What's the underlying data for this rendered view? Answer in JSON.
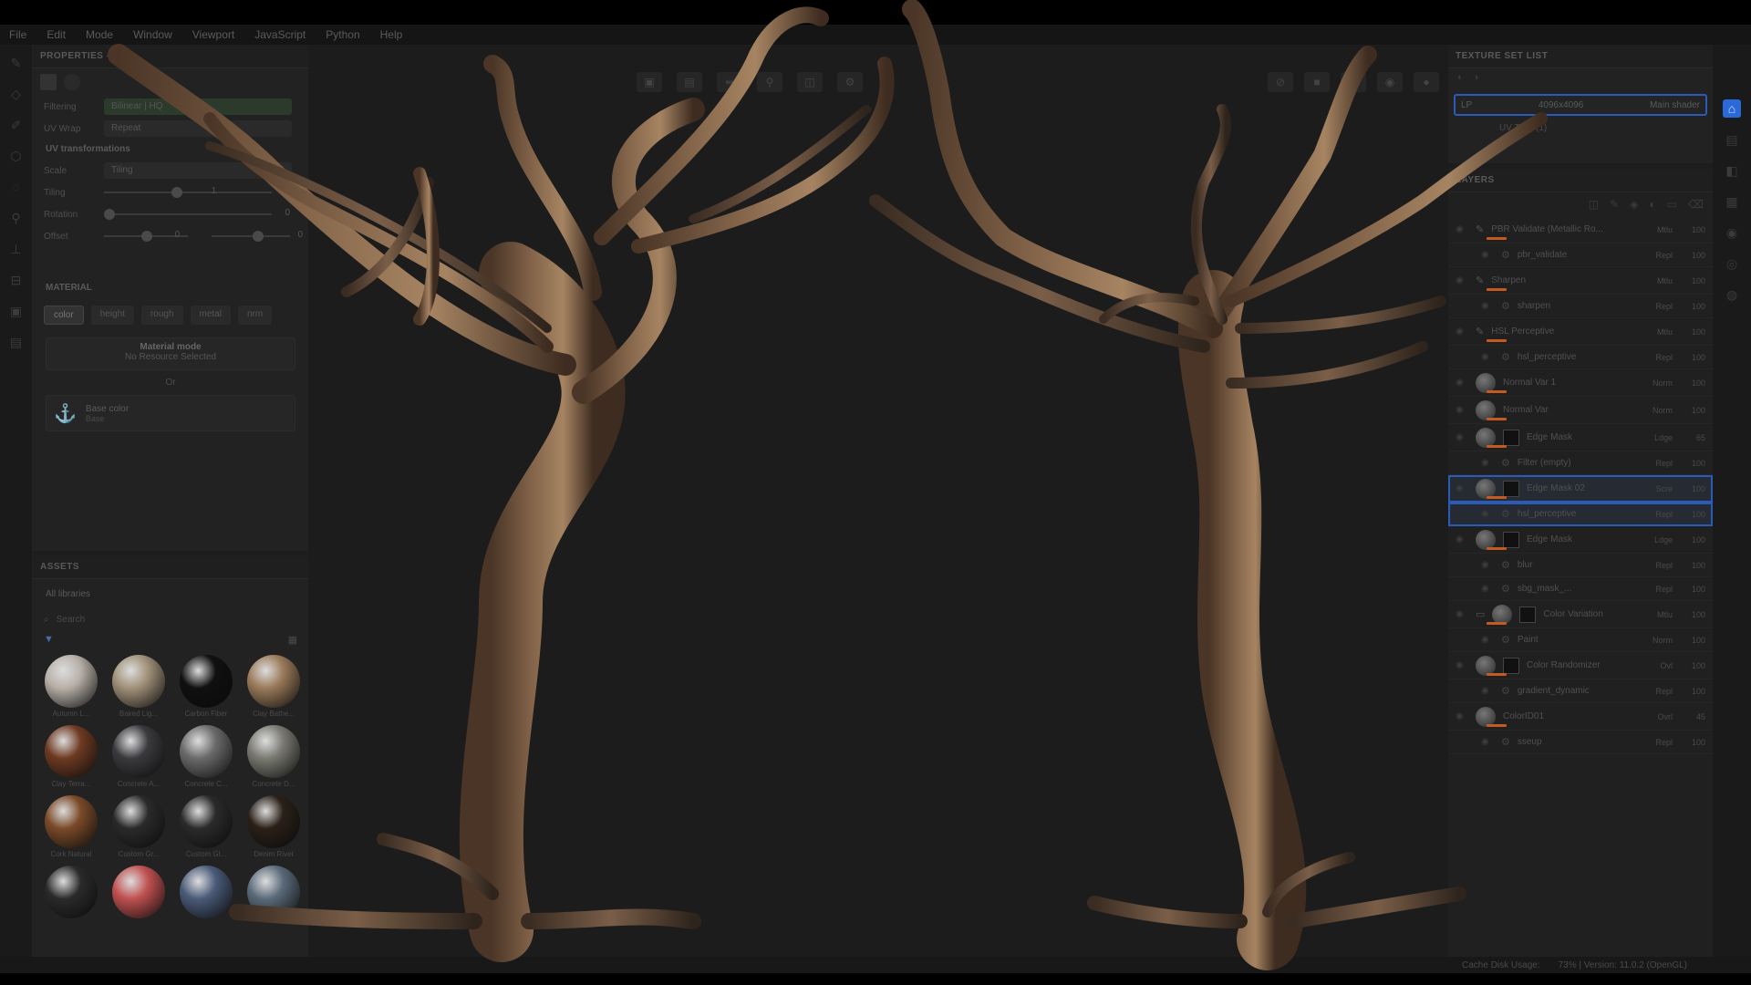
{
  "menu": [
    "File",
    "Edit",
    "Mode",
    "Window",
    "Viewport",
    "JavaScript",
    "Python",
    "Help"
  ],
  "properties": {
    "title": "PROPERTIES - FILL",
    "filtering_label": "Filtering",
    "filtering_value": "Bilinear | HQ",
    "uvwrap_label": "UV Wrap",
    "uvwrap_value": "Repeat",
    "uv_section": "UV transformations",
    "scale_label": "Scale",
    "scale_value": "Tiling",
    "tiling_label": "Tiling",
    "tiling_value": "1",
    "rotation_label": "Rotation",
    "rotation_value": "0",
    "offset_label": "Offset",
    "offset_value_1": "0",
    "offset_value_2": "0"
  },
  "material": {
    "title": "MATERIAL",
    "tabs": [
      "color",
      "height",
      "rough",
      "metal",
      "nrm"
    ],
    "mode_title": "Material mode",
    "mode_subtitle": "No Resource Selected",
    "or_label": "Or",
    "base_color_label": "Base color",
    "base_color_value": "Base"
  },
  "assets": {
    "title": "ASSETS",
    "library": "All libraries",
    "search_placeholder": "Search",
    "items": [
      {
        "name": "Autumn L...",
        "color": "#b8b0a8"
      },
      {
        "name": "Baked Lig...",
        "color": "#a09078"
      },
      {
        "name": "Carbon Fiber",
        "color": "#101010"
      },
      {
        "name": "Clay Bathe...",
        "color": "#9a7a5a"
      },
      {
        "name": "Clay Terra...",
        "color": "#6e3a22"
      },
      {
        "name": "Concrete A...",
        "color": "#3a3a3e"
      },
      {
        "name": "Concrete C...",
        "color": "#6a6a6a"
      },
      {
        "name": "Concrete D...",
        "color": "#7a7a72"
      },
      {
        "name": "Cork Natural",
        "color": "#7a4a28"
      },
      {
        "name": "Custom Gr...",
        "color": "#2a2a2a"
      },
      {
        "name": "Custom Gl...",
        "color": "#2a2a2a"
      },
      {
        "name": "Denim Rivet",
        "color": "#2a2018"
      },
      {
        "name": "",
        "color": "#2a2a2a"
      },
      {
        "name": "",
        "color": "#c05050"
      },
      {
        "name": "",
        "color": "#4a5a78"
      },
      {
        "name": "",
        "color": "#5a6a7a"
      }
    ]
  },
  "texture_set": {
    "title": "TEXTURE SET LIST",
    "name": "LP",
    "resolution": "4096x4096",
    "shader": "Main shader",
    "uv_tiles": "UV Tiles (1)"
  },
  "layers": {
    "title": "LAYERS",
    "items": [
      {
        "name": "PBR Validate (Metallic Ro...",
        "blend": "Mtlu",
        "opacity": "100",
        "sub": false,
        "kind": "paint"
      },
      {
        "name": "pbr_validate",
        "blend": "Repl",
        "opacity": "100",
        "sub": true
      },
      {
        "name": "Sharpen",
        "blend": "Mtlu",
        "opacity": "100",
        "sub": false,
        "kind": "paint"
      },
      {
        "name": "sharpen",
        "blend": "Repl",
        "opacity": "100",
        "sub": true
      },
      {
        "name": "HSL Perceptive",
        "blend": "Mtlu",
        "opacity": "100",
        "sub": false,
        "kind": "paint"
      },
      {
        "name": "hsl_perceptive",
        "blend": "Repl",
        "opacity": "100",
        "sub": true
      },
      {
        "name": "Normal Var 1",
        "blend": "Norm",
        "opacity": "100",
        "sub": false,
        "kind": "ball"
      },
      {
        "name": "Normal Var",
        "blend": "Norm",
        "opacity": "100",
        "sub": false,
        "kind": "ball"
      },
      {
        "name": "Edge Mask",
        "blend": "Ldge",
        "opacity": "65",
        "sub": false,
        "kind": "ballmask"
      },
      {
        "name": "Filter (empty)",
        "blend": "Repl",
        "opacity": "100",
        "sub": true
      },
      {
        "name": "Edge Mask 02",
        "blend": "Scre",
        "opacity": "100",
        "sub": false,
        "kind": "ballmask",
        "selected": true
      },
      {
        "name": "hsl_perceptive",
        "blend": "Repl",
        "opacity": "100",
        "sub": true,
        "selected": true
      },
      {
        "name": "Edge Mask",
        "blend": "Ldge",
        "opacity": "100",
        "sub": false,
        "kind": "ballmask"
      },
      {
        "name": "blur",
        "blend": "Repl",
        "opacity": "100",
        "sub": true
      },
      {
        "name": "sbg_mask_...",
        "blend": "Repl",
        "opacity": "100",
        "sub": true
      },
      {
        "name": "Color Variation",
        "blend": "Mtlu",
        "opacity": "100",
        "sub": false,
        "kind": "folder"
      },
      {
        "name": "Paint",
        "blend": "Norm",
        "opacity": "100",
        "sub": true
      },
      {
        "name": "Color Randomizer",
        "blend": "Ovl",
        "opacity": "100",
        "sub": false,
        "kind": "ballmask"
      },
      {
        "name": "gradient_dynamic",
        "blend": "Repl",
        "opacity": "100",
        "sub": true
      },
      {
        "name": "ColorID01",
        "blend": "Ovrl",
        "opacity": "45",
        "sub": false,
        "kind": "ball"
      },
      {
        "name": "sseup",
        "blend": "Repl",
        "opacity": "100",
        "sub": true
      }
    ]
  },
  "status": {
    "cache": "Cache Disk Usage:",
    "version": "73% | Version: 11.0.2 (OpenGL)"
  }
}
